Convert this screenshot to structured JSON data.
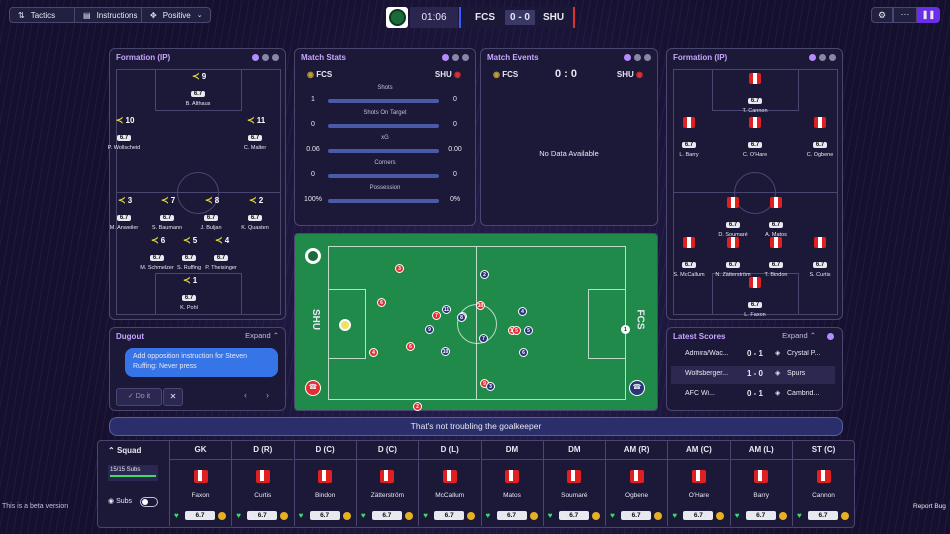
{
  "toolbar": {
    "tactics_label": "Tactics",
    "instructions_label": "Instructions",
    "mentality_label": "Positive",
    "clock": "01:06",
    "home_abbr": "FCS",
    "away_abbr": "SHU",
    "score": "0 - 0"
  },
  "formation_left": {
    "title": "Formation (IP)",
    "players": [
      {
        "num": "9",
        "rating": "6.7",
        "name": "B. Althaus"
      },
      {
        "num": "10",
        "rating": "6.7",
        "name": "P. Wollscheid"
      },
      {
        "num": "11",
        "rating": "6.7",
        "name": "C. Malter"
      },
      {
        "num": "3",
        "rating": "6.7",
        "name": "M. Anweiler"
      },
      {
        "num": "7",
        "rating": "6.7",
        "name": "S. Baumann"
      },
      {
        "num": "8",
        "rating": "6.7",
        "name": "J. Buljan"
      },
      {
        "num": "2",
        "rating": "6.7",
        "name": "K. Quasten"
      },
      {
        "num": "6",
        "rating": "6.7",
        "name": "M. Schmelzer"
      },
      {
        "num": "5",
        "rating": "6.7",
        "name": "S. Ruffing"
      },
      {
        "num": "4",
        "rating": "6.7",
        "name": "P. Theisinger"
      },
      {
        "num": "1",
        "rating": "6.7",
        "name": "K. Pohl"
      }
    ]
  },
  "match_stats": {
    "title": "Match Stats",
    "home": "FCS",
    "away": "SHU",
    "rows": [
      {
        "label": "Shots",
        "home": "1",
        "away": "0"
      },
      {
        "label": "Shots On Target",
        "home": "0",
        "away": "0"
      },
      {
        "label": "xG",
        "home": "0.06",
        "away": "0.00"
      },
      {
        "label": "Corners",
        "home": "0",
        "away": "0"
      },
      {
        "label": "Possession",
        "home": "100%",
        "away": "0%"
      }
    ]
  },
  "match_events": {
    "title": "Match Events",
    "home": "FCS",
    "away": "SHU",
    "score": "0 : 0",
    "empty": "No Data Available"
  },
  "formation_right": {
    "title": "Formation (IP)",
    "players": [
      {
        "num": "9",
        "rating": "6.7",
        "name": "T. Cannon"
      },
      {
        "num": "10",
        "rating": "6.7",
        "name": "L. Barry"
      },
      {
        "num": "8",
        "rating": "6.7",
        "name": "C. O'Hare"
      },
      {
        "num": "11",
        "rating": "6.7",
        "name": "C. Ogbene"
      },
      {
        "num": "7",
        "rating": "6.7",
        "name": "D. Soumaré"
      },
      {
        "num": "6",
        "rating": "6.7",
        "name": "A. Matos"
      },
      {
        "num": "3",
        "rating": "6.7",
        "name": "S. McCallum"
      },
      {
        "num": "5",
        "rating": "6.7",
        "name": "N. Zätterström"
      },
      {
        "num": "4",
        "rating": "6.7",
        "name": "T. Bindon"
      },
      {
        "num": "2",
        "rating": "6.7",
        "name": "S. Curtis"
      },
      {
        "num": "1",
        "rating": "6.7",
        "name": "L. Faxon"
      }
    ]
  },
  "pitch": {
    "left_team": "SHU",
    "right_team": "FCS",
    "red_markers": [
      "3",
      "6",
      "4",
      "6",
      "7",
      "10",
      "8",
      "11",
      "5",
      "9",
      "2"
    ],
    "blue_markers": [
      "2",
      "11",
      "9",
      "8",
      "10",
      "7",
      "4",
      "5",
      "6",
      "3",
      "1"
    ]
  },
  "dugout": {
    "title": "Dugout",
    "expand_label": "Expand",
    "message": "Add opposition instruction for Steven Ruffing: Never press",
    "do_it_label": "Do it"
  },
  "latest_scores": {
    "title": "Latest Scores",
    "expand_label": "Expand",
    "rows": [
      {
        "home": "Admira/Wac...",
        "score": "0 - 1",
        "away": "Crystal P..."
      },
      {
        "home": "Wolfsberger...",
        "score": "1 - 0",
        "away": "Spurs"
      },
      {
        "home": "AFC Wi...",
        "score": "0 - 1",
        "away": "Cambrid..."
      }
    ]
  },
  "commentary": "That's not troubling the goalkeeper",
  "squad": {
    "title": "Squad",
    "subs_count": "15/15 Subs",
    "subs_label": "Subs",
    "players": [
      {
        "pos": "GK",
        "name": "Faxon",
        "rating": "6.7"
      },
      {
        "pos": "D (R)",
        "name": "Curtis",
        "rating": "6.7"
      },
      {
        "pos": "D (C)",
        "name": "Bindon",
        "rating": "6.7"
      },
      {
        "pos": "D (C)",
        "name": "Zätterström",
        "rating": "6.7"
      },
      {
        "pos": "D (L)",
        "name": "McCallum",
        "rating": "6.7"
      },
      {
        "pos": "DM",
        "name": "Matos",
        "rating": "6.7"
      },
      {
        "pos": "DM",
        "name": "Soumaré",
        "rating": "6.7"
      },
      {
        "pos": "AM (R)",
        "name": "Ogbene",
        "rating": "6.7"
      },
      {
        "pos": "AM (C)",
        "name": "O'Hare",
        "rating": "6.7"
      },
      {
        "pos": "AM (L)",
        "name": "Barry",
        "rating": "6.7"
      },
      {
        "pos": "ST (C)",
        "name": "Cannon",
        "rating": "6.7"
      }
    ]
  },
  "footer": {
    "beta_label": "This is a beta version",
    "report_bug_label": "Report Bug"
  }
}
